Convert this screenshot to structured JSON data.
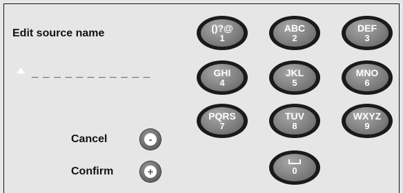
{
  "dialog": {
    "title": "Edit source name",
    "entry_value": "_ _ _ _ _ _ _ _ _ _ _"
  },
  "actions": {
    "cancel_label": "Cancel",
    "cancel_symbol": "-",
    "confirm_label": "Confirm",
    "confirm_symbol": "+"
  },
  "keypad": {
    "keys": [
      {
        "letters": "()?@",
        "digit": "1"
      },
      {
        "letters": "ABC",
        "digit": "2"
      },
      {
        "letters": "DEF",
        "digit": "3"
      },
      {
        "letters": "GHI",
        "digit": "4"
      },
      {
        "letters": "JKL",
        "digit": "5"
      },
      {
        "letters": "MNO",
        "digit": "6"
      },
      {
        "letters": "PQRS",
        "digit": "7"
      },
      {
        "letters": "TUV",
        "digit": "8"
      },
      {
        "letters": "WXYZ",
        "digit": "9"
      },
      {
        "letters": "",
        "digit": "0",
        "icon": "space-bar-icon"
      }
    ]
  }
}
